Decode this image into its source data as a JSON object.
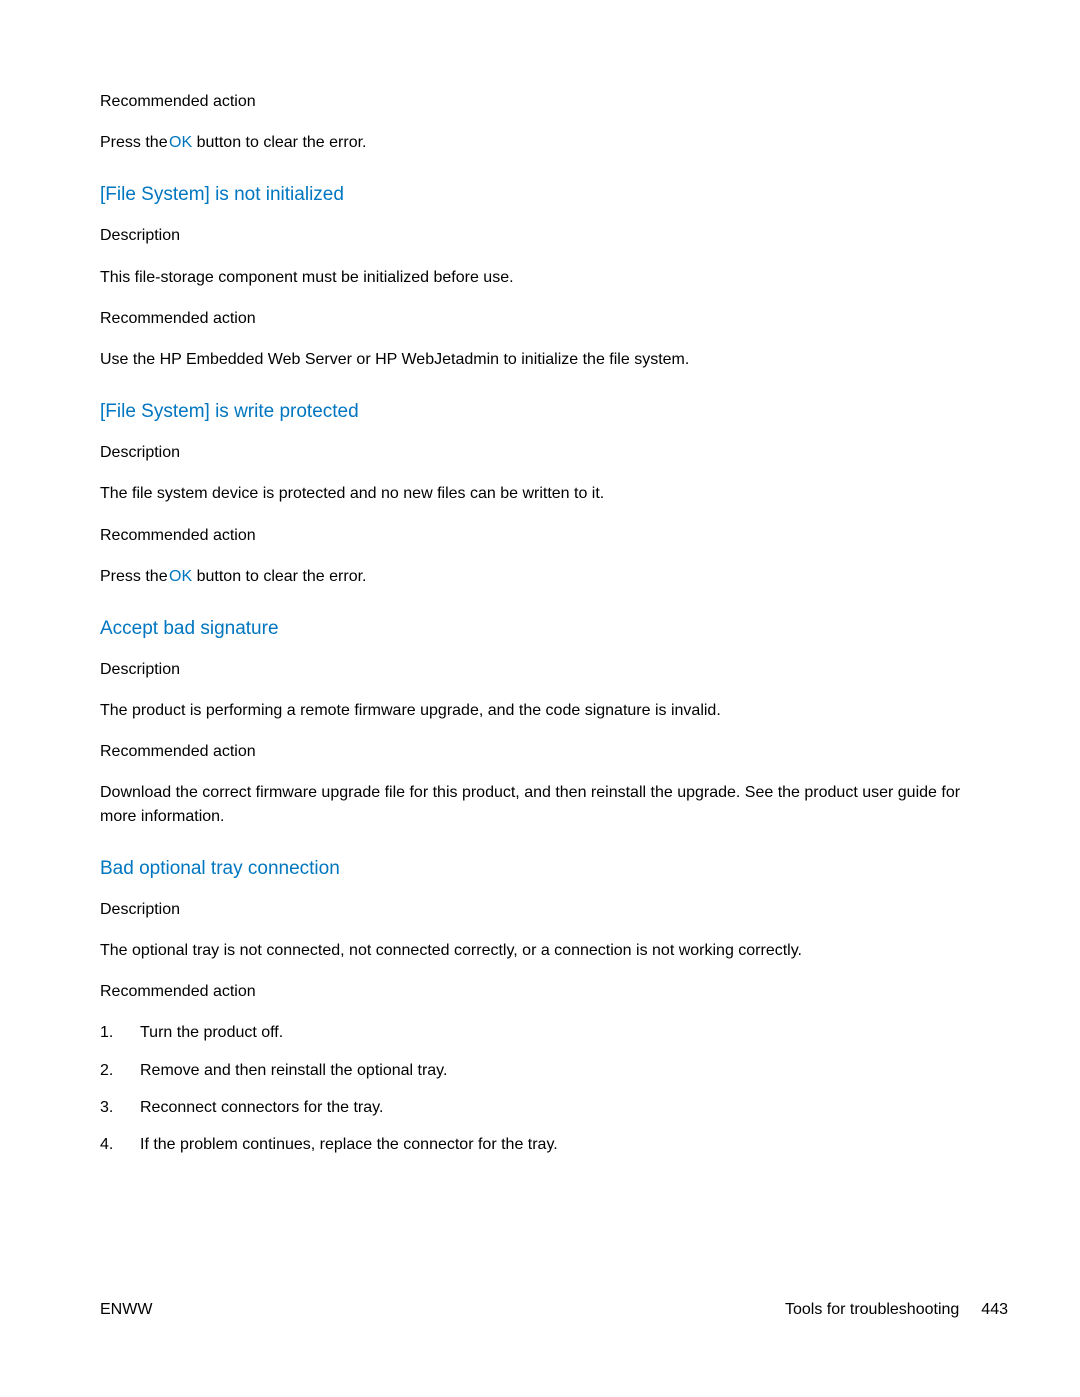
{
  "intro": {
    "rec_label": "Recommended action",
    "press_pre": "Press the",
    "ok": " OK ",
    "press_post": "button to clear the error."
  },
  "sections": {
    "fs_not_init": {
      "heading": "[File System] is not initialized",
      "desc_label": "Description",
      "desc": "This file-storage component must be initialized before use.",
      "rec_label": "Recommended action",
      "rec": "Use the HP Embedded Web Server or HP WebJetadmin to initialize the file system."
    },
    "fs_write_prot": {
      "heading": "[File System] is write protected",
      "desc_label": "Description",
      "desc": "The file system device is protected and no new files can be written to it.",
      "rec_label": "Recommended action",
      "press_pre": "Press the",
      "ok": " OK ",
      "press_post": "button to clear the error."
    },
    "accept_bad_sig": {
      "heading": "Accept bad signature",
      "desc_label": "Description",
      "desc": "The product is performing a remote firmware upgrade, and the code signature is invalid.",
      "rec_label": "Recommended action",
      "rec": "Download the correct firmware upgrade file for this product, and then reinstall the upgrade. See the product user guide for more information."
    },
    "bad_tray": {
      "heading": "Bad optional tray connection",
      "desc_label": "Description",
      "desc": "The optional tray is not connected, not connected correctly, or a connection is not working correctly.",
      "rec_label": "Recommended action",
      "steps": [
        "Turn the product off.",
        "Remove and then reinstall the optional tray.",
        "Reconnect connectors for the tray.",
        "If the problem continues, replace the connector for the tray."
      ],
      "nums": [
        "1.",
        "2.",
        "3.",
        "4."
      ]
    }
  },
  "footer": {
    "left": "ENWW",
    "right_label": "Tools for troubleshooting",
    "page_num": "443"
  }
}
